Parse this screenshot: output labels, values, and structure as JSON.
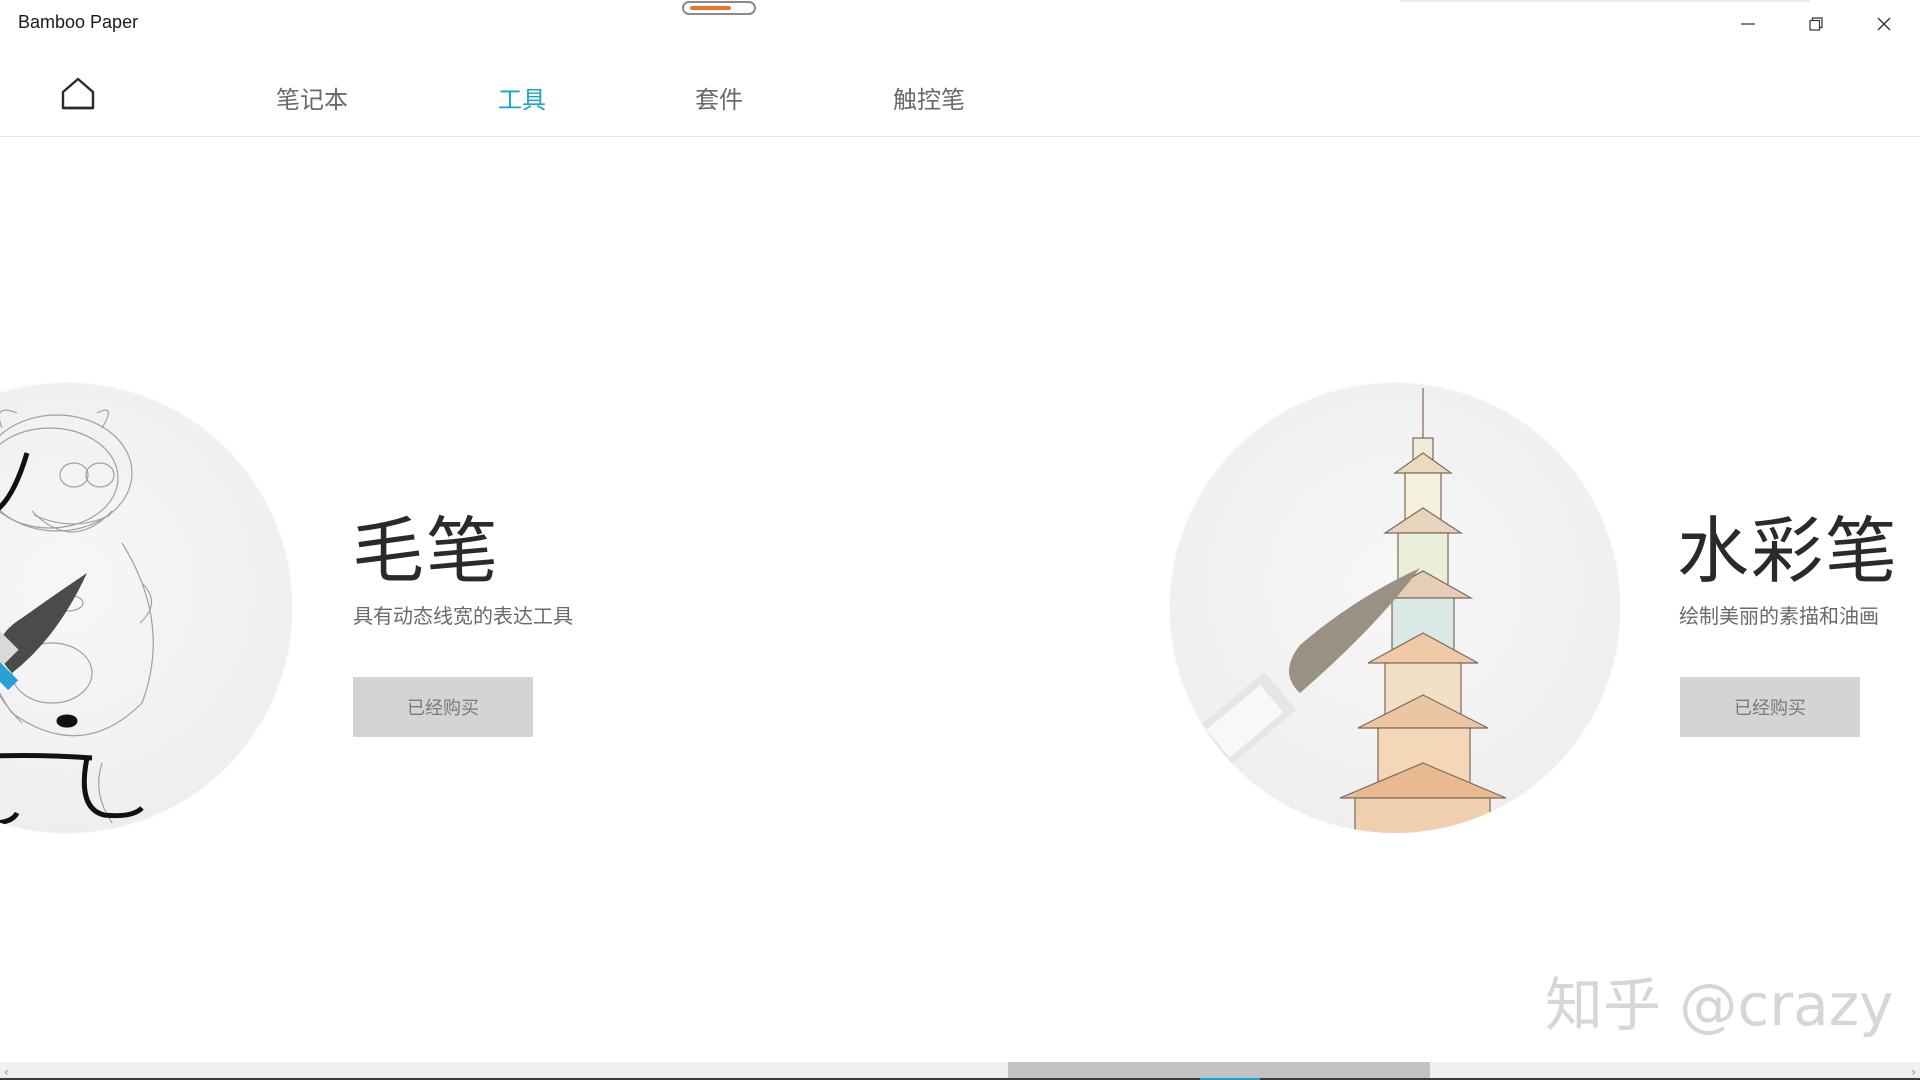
{
  "app": {
    "title": "Bamboo Paper",
    "progress": 0.7
  },
  "window_controls": {
    "minimize_icon": "minimize-icon",
    "restore_icon": "restore-icon",
    "close_icon": "close-icon"
  },
  "nav": {
    "home_icon": "home-icon",
    "tabs": [
      {
        "label": "笔记本",
        "active": false
      },
      {
        "label": "工具",
        "active": true
      },
      {
        "label": "套件",
        "active": false
      },
      {
        "label": "触控笔",
        "active": false
      }
    ],
    "active_color": "#1ca3c8",
    "inactive_color": "#6a6a6a"
  },
  "tools": [
    {
      "title": "毛笔",
      "description": "具有动态线宽的表达工具",
      "button_label": "已经购买",
      "illustration": "brush-sketch-bear"
    },
    {
      "title": "水彩笔",
      "description": "绘制美丽的素描和油画",
      "button_label": "已经购买",
      "illustration": "watercolor-pagoda"
    }
  ],
  "watermark": "知乎 @crazy",
  "scrollbar": {
    "left_arrow": "‹",
    "right_arrow": "›"
  }
}
